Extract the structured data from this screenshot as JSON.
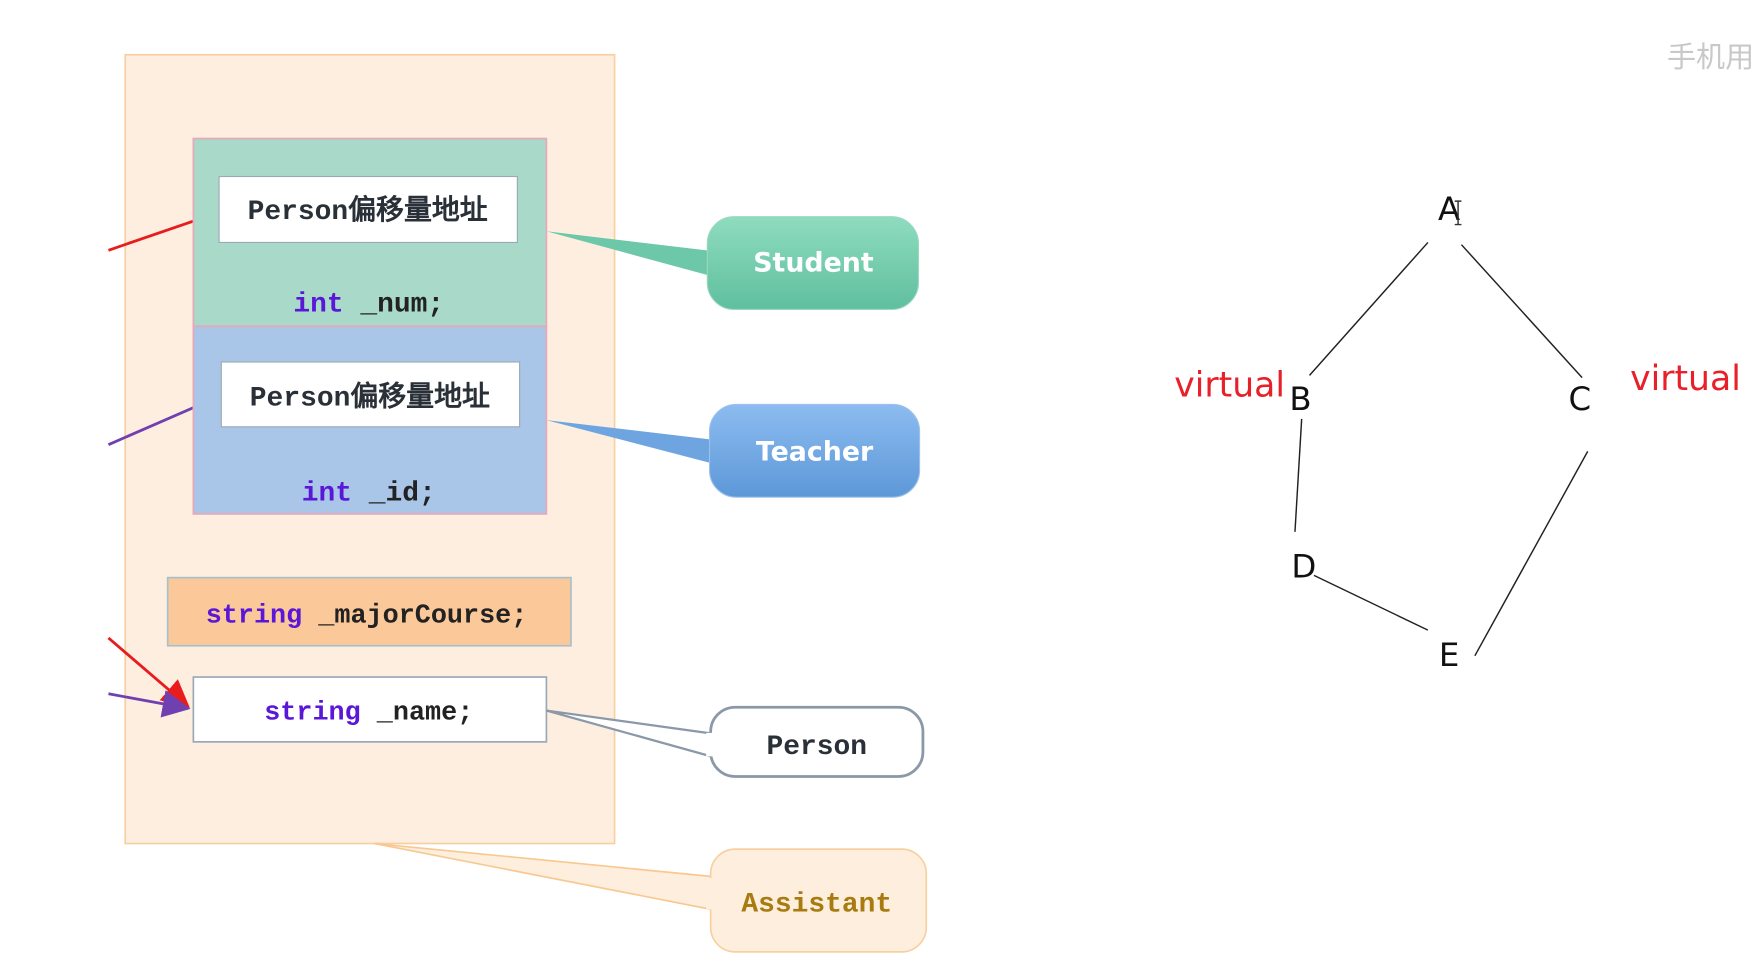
{
  "watermark": "手机用",
  "memory_layout": {
    "student_block": {
      "offset_label": "Person偏移量地址",
      "member_type": "int",
      "member_name": " _num;"
    },
    "teacher_block": {
      "offset_label": "Person偏移量地址",
      "member_type": "int",
      "member_name": " _id;"
    },
    "assistant_member": {
      "type": "string",
      "name": " _majorCourse;"
    },
    "person_member": {
      "type": "string",
      "name": " _name;"
    }
  },
  "callouts": {
    "student": "Student",
    "teacher": "Teacher",
    "person": "Person",
    "assistant": "Assistant"
  },
  "graph": {
    "nodes": [
      "A",
      "B",
      "C",
      "D",
      "E"
    ],
    "edges": [
      [
        "A",
        "B"
      ],
      [
        "A",
        "C"
      ],
      [
        "B",
        "D"
      ],
      [
        "D",
        "E"
      ],
      [
        "C",
        "E"
      ]
    ],
    "annotations": {
      "b": "virtual",
      "c": "virtual"
    }
  },
  "colors": {
    "outer": "#fdeee0",
    "student": "#a9d9c9",
    "teacher": "#a9c5e8",
    "major_course": "#fbc89a",
    "keyword": "#5a17d8",
    "virtual": "#e8202a",
    "assistant_text": "#a87a10"
  }
}
